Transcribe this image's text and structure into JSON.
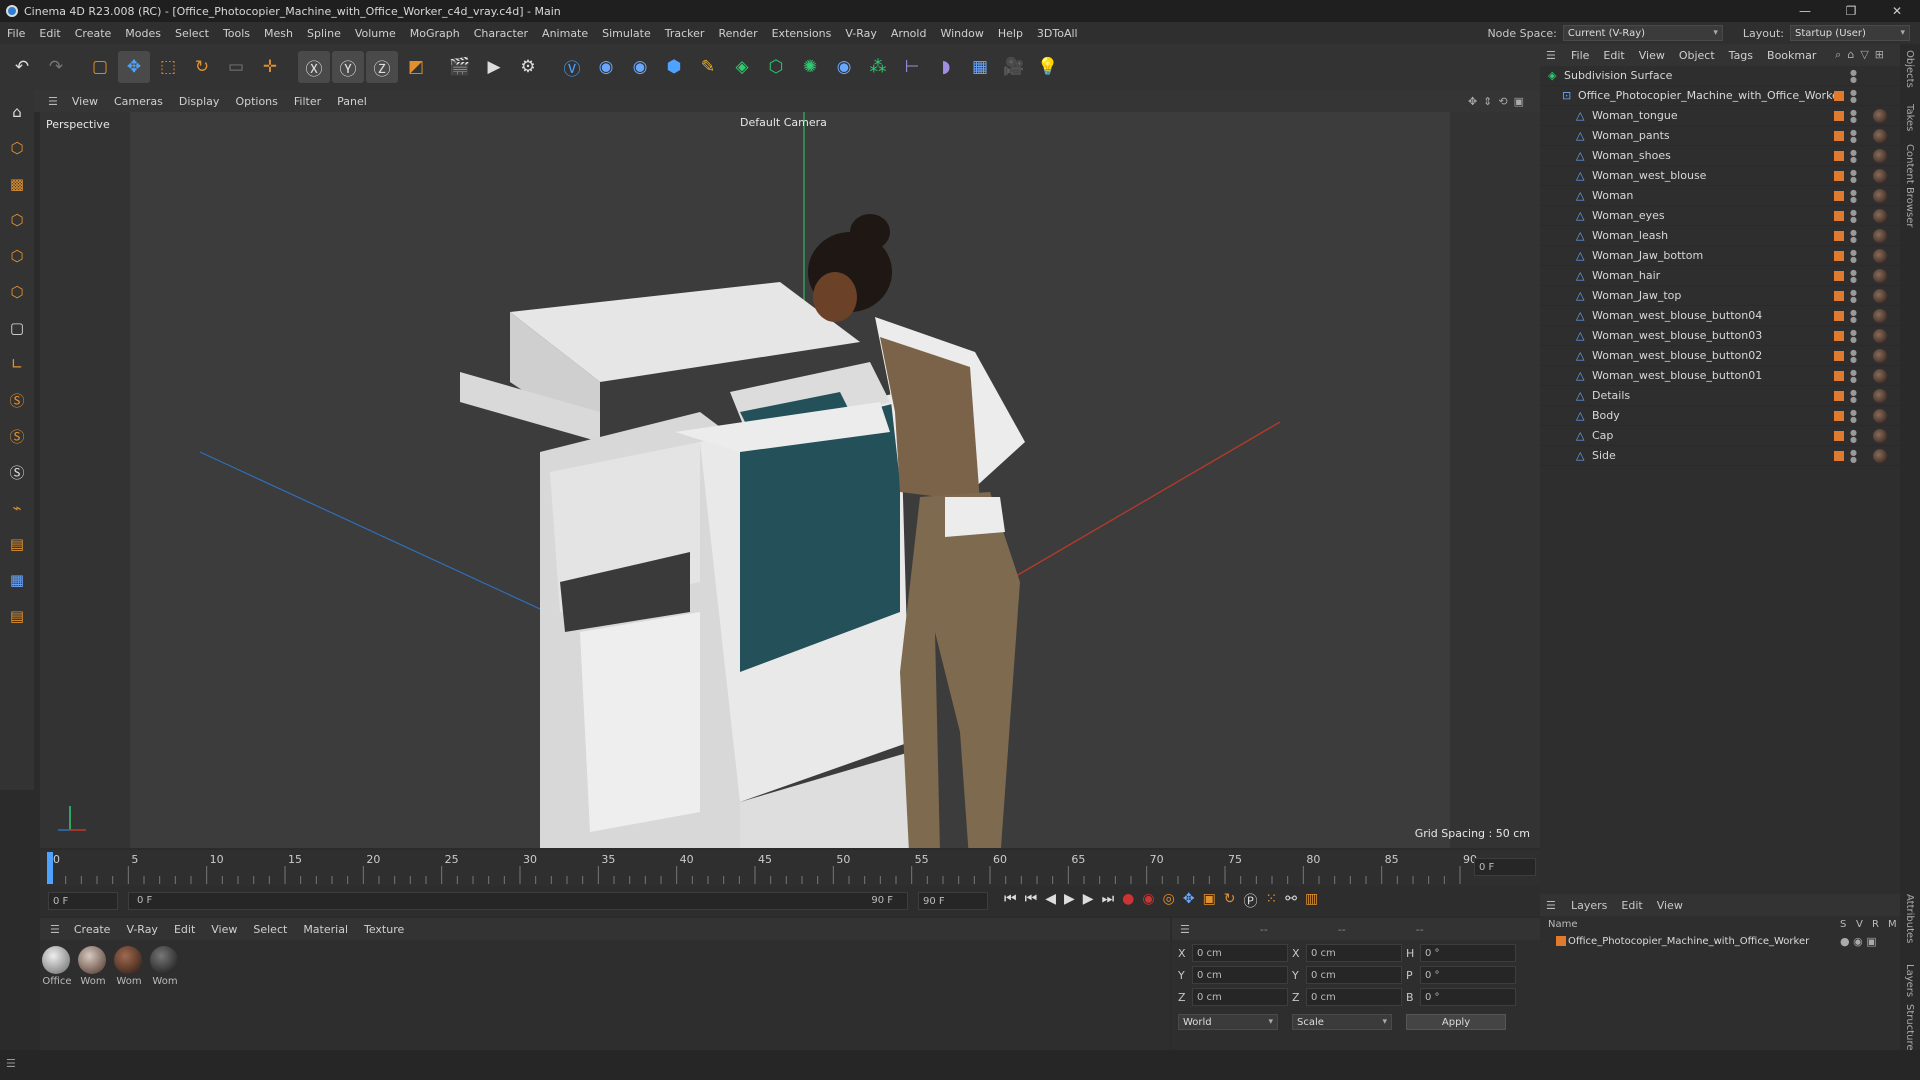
{
  "titlebar": {
    "title": "Cinema 4D R23.008 (RC) - [Office_Photocopier_Machine_with_Office_Worker_c4d_vray.c4d] - Main",
    "minimize": "—",
    "restore": "❐",
    "close": "✕"
  },
  "menu": [
    "File",
    "Edit",
    "Create",
    "Modes",
    "Select",
    "Tools",
    "Mesh",
    "Spline",
    "Volume",
    "MoGraph",
    "Character",
    "Animate",
    "Simulate",
    "Tracker",
    "Render",
    "Extensions",
    "V-Ray",
    "Arnold",
    "Window",
    "Help",
    "3DToAll"
  ],
  "nodespace": {
    "label": "Node Space:",
    "value": "Current (V-Ray)"
  },
  "layout": {
    "label": "Layout:",
    "value": "Startup (User)"
  },
  "viewport_menu": [
    "View",
    "Cameras",
    "Display",
    "Options",
    "Filter",
    "Panel"
  ],
  "viewport": {
    "name": "Perspective",
    "camera": "Default Camera",
    "grid_spacing": "Grid Spacing : 50 cm"
  },
  "timeline": {
    "ticks": [
      "0",
      "5",
      "10",
      "15",
      "20",
      "25",
      "30",
      "35",
      "40",
      "45",
      "50",
      "55",
      "60",
      "65",
      "70",
      "75",
      "80",
      "85",
      "90"
    ],
    "current_frame_field": "0 F",
    "start_field": "0 F",
    "range_start": "0 F",
    "range_end": "90 F",
    "end_field": "90 F"
  },
  "material_menu": [
    "Create",
    "V-Ray",
    "Edit",
    "View",
    "Select",
    "Material",
    "Texture"
  ],
  "materials": [
    {
      "label": "Office"
    },
    {
      "label": "Wom"
    },
    {
      "label": "Wom"
    },
    {
      "label": "Wom"
    }
  ],
  "coords": {
    "header_dashes": [
      "--",
      "--",
      "--"
    ],
    "rows": [
      {
        "axis": "X",
        "pos": "0 cm",
        "axis2": "X",
        "size": "0 cm",
        "rlabel": "H",
        "rot": "0 °"
      },
      {
        "axis": "Y",
        "pos": "0 cm",
        "axis2": "Y",
        "size": "0 cm",
        "rlabel": "P",
        "rot": "0 °"
      },
      {
        "axis": "Z",
        "pos": "0 cm",
        "axis2": "Z",
        "size": "0 cm",
        "rlabel": "B",
        "rot": "0 °"
      }
    ],
    "world": "World",
    "scale": "Scale",
    "apply": "Apply"
  },
  "object_menu": [
    "File",
    "Edit",
    "View",
    "Object",
    "Tags",
    "Bookmar"
  ],
  "objects": [
    {
      "name": "Subdivision Surface",
      "indent": 0
    },
    {
      "name": "Office_Photocopier_Machine_with_Office_Worker",
      "indent": 1
    },
    {
      "name": "Woman_tongue",
      "indent": 2
    },
    {
      "name": "Woman_pants",
      "indent": 2
    },
    {
      "name": "Woman_shoes",
      "indent": 2
    },
    {
      "name": "Woman_west_blouse",
      "indent": 2
    },
    {
      "name": "Woman",
      "indent": 2
    },
    {
      "name": "Woman_eyes",
      "indent": 2
    },
    {
      "name": "Woman_leash",
      "indent": 2
    },
    {
      "name": "Woman_Jaw_bottom",
      "indent": 2
    },
    {
      "name": "Woman_hair",
      "indent": 2
    },
    {
      "name": "Woman_Jaw_top",
      "indent": 2
    },
    {
      "name": "Woman_west_blouse_button04",
      "indent": 2
    },
    {
      "name": "Woman_west_blouse_button03",
      "indent": 2
    },
    {
      "name": "Woman_west_blouse_button02",
      "indent": 2
    },
    {
      "name": "Woman_west_blouse_button01",
      "indent": 2
    },
    {
      "name": "Details",
      "indent": 2
    },
    {
      "name": "Body",
      "indent": 2
    },
    {
      "name": "Cap",
      "indent": 2
    },
    {
      "name": "Side",
      "indent": 2
    }
  ],
  "layers_menu": [
    "Layers",
    "Edit",
    "View"
  ],
  "layers": {
    "columns": [
      "Name",
      "S",
      "V",
      "R",
      "M"
    ],
    "rows": [
      {
        "name": "Office_Photocopier_Machine_with_Office_Worker"
      }
    ]
  },
  "right_tabs": [
    "Objects",
    "Takes",
    "Content Browser",
    "Attributes",
    "Layers",
    "Structure"
  ],
  "colors": {
    "accent": "#e07a2e",
    "axis_x": "#c0392b",
    "axis_z": "#2e6fb7",
    "axis_y": "#2ecc71"
  }
}
